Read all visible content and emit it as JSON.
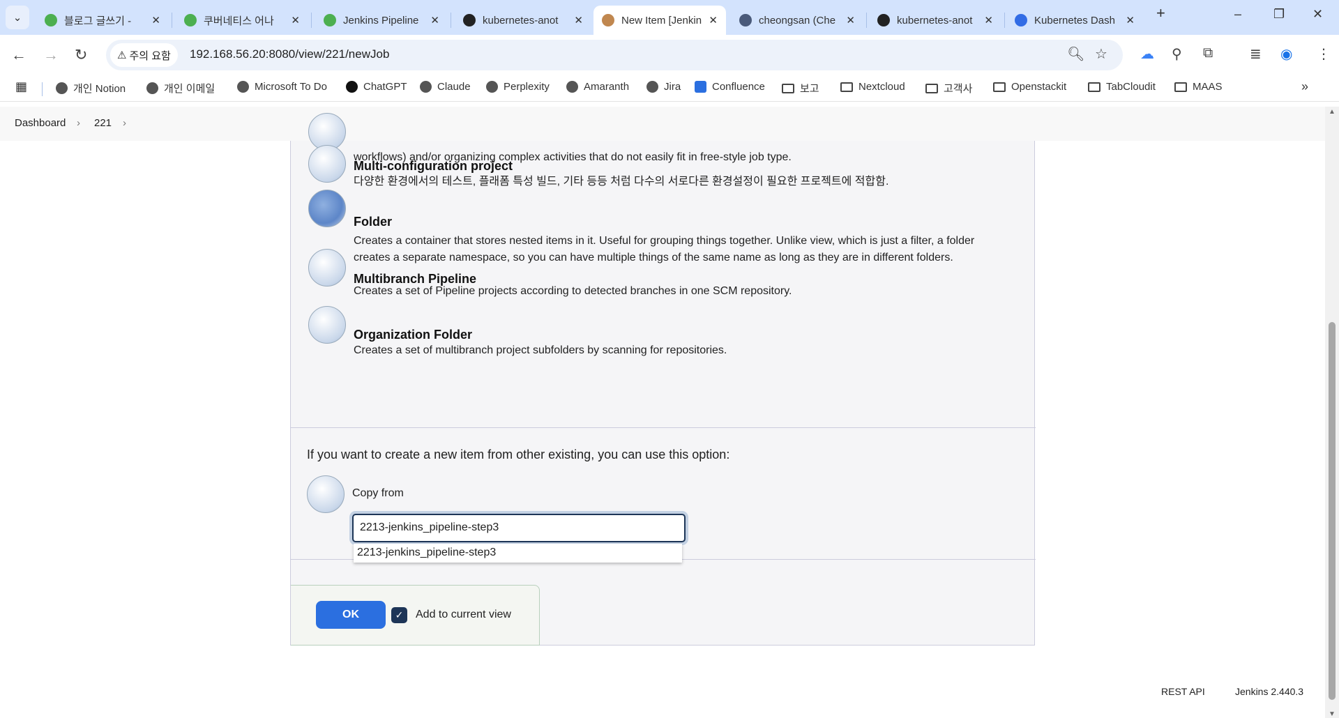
{
  "browser": {
    "tabs": [
      {
        "title": "블로그 글쓰기 -",
        "icon": "tistory-icon",
        "color": "#4caf50"
      },
      {
        "title": "쿠버네티스 어나",
        "icon": "tistory-icon",
        "color": "#4caf50"
      },
      {
        "title": "Jenkins Pipeline",
        "icon": "apple-icon",
        "color": "#4caf50"
      },
      {
        "title": "kubernetes-anot",
        "icon": "github-icon",
        "color": "#222"
      },
      {
        "title": "New Item [Jenkins]",
        "icon": "jenkins-icon",
        "color": "#c0874f",
        "active": true
      },
      {
        "title": "cheongsan (Che",
        "icon": "docker-icon",
        "color": "#4a5a7a"
      },
      {
        "title": "kubernetes-anot",
        "icon": "github-icon",
        "color": "#222"
      },
      {
        "title": "Kubernetes Dash",
        "icon": "kubernetes-icon",
        "color": "#326ce5"
      }
    ],
    "security_label": "주의 요함",
    "url": "192.168.56.20:8080/view/221/newJob",
    "bookmarks": [
      {
        "label": "개인 Notion",
        "icon": "globe-icon"
      },
      {
        "label": "개인 이메일",
        "icon": "globe-icon"
      },
      {
        "label": "Microsoft To Do",
        "icon": "globe-icon"
      },
      {
        "label": "ChatGPT",
        "icon": "chatgpt-icon"
      },
      {
        "label": "Claude",
        "icon": "globe-icon"
      },
      {
        "label": "Perplexity",
        "icon": "globe-icon"
      },
      {
        "label": "Amaranth",
        "icon": "globe-icon"
      },
      {
        "label": "Jira",
        "icon": "globe-icon"
      },
      {
        "label": "Confluence",
        "icon": "confluence-icon"
      },
      {
        "label": "보고",
        "icon": "folder-icon"
      },
      {
        "label": "Nextcloud",
        "icon": "folder-icon"
      },
      {
        "label": "고객사",
        "icon": "folder-icon"
      },
      {
        "label": "Openstackit",
        "icon": "folder-icon"
      },
      {
        "label": "TabCloudit",
        "icon": "folder-icon"
      },
      {
        "label": "MAAS",
        "icon": "folder-icon"
      }
    ]
  },
  "breadcrumb": [
    "Dashboard",
    "221"
  ],
  "items": [
    {
      "title": "",
      "desc": "workflows) and/or organizing complex activities that do not easily fit in free-style job type.",
      "icon": "pipeline-icon"
    },
    {
      "title": "Multi-configuration project",
      "desc": "다양한 환경에서의 테스트, 플래폼 특성 빌드, 기타 등등 처럼 다수의 서로다른 환경설정이 필요한 프로젝트에 적합함.",
      "icon": "multi-config-icon"
    },
    {
      "title": "Folder",
      "desc": "Creates a container that stores nested items in it. Useful for grouping things together. Unlike view, which is just a filter, a folder creates a separate namespace, so you can have multiple things of the same name as long as they are in different folders.",
      "icon": "folder-icon"
    },
    {
      "title": "Multibranch Pipeline",
      "desc": "Creates a set of Pipeline projects according to detected branches in one SCM repository.",
      "icon": "multibranch-icon"
    },
    {
      "title": "Organization Folder",
      "desc": "Creates a set of multibranch project subfolders by scanning for repositories.",
      "icon": "organization-folder-icon"
    }
  ],
  "copy": {
    "intro": "If you want to create a new item from other existing, you can use this option:",
    "label": "Copy from",
    "value": "2213-jenkins_pipeline-step3",
    "suggestion": "2213-jenkins_pipeline-step3"
  },
  "form": {
    "ok": "OK",
    "add_to_view": "Add to current view",
    "add_to_view_checked": true
  },
  "footer": {
    "rest_api": "REST API",
    "version": "Jenkins 2.440.3"
  }
}
